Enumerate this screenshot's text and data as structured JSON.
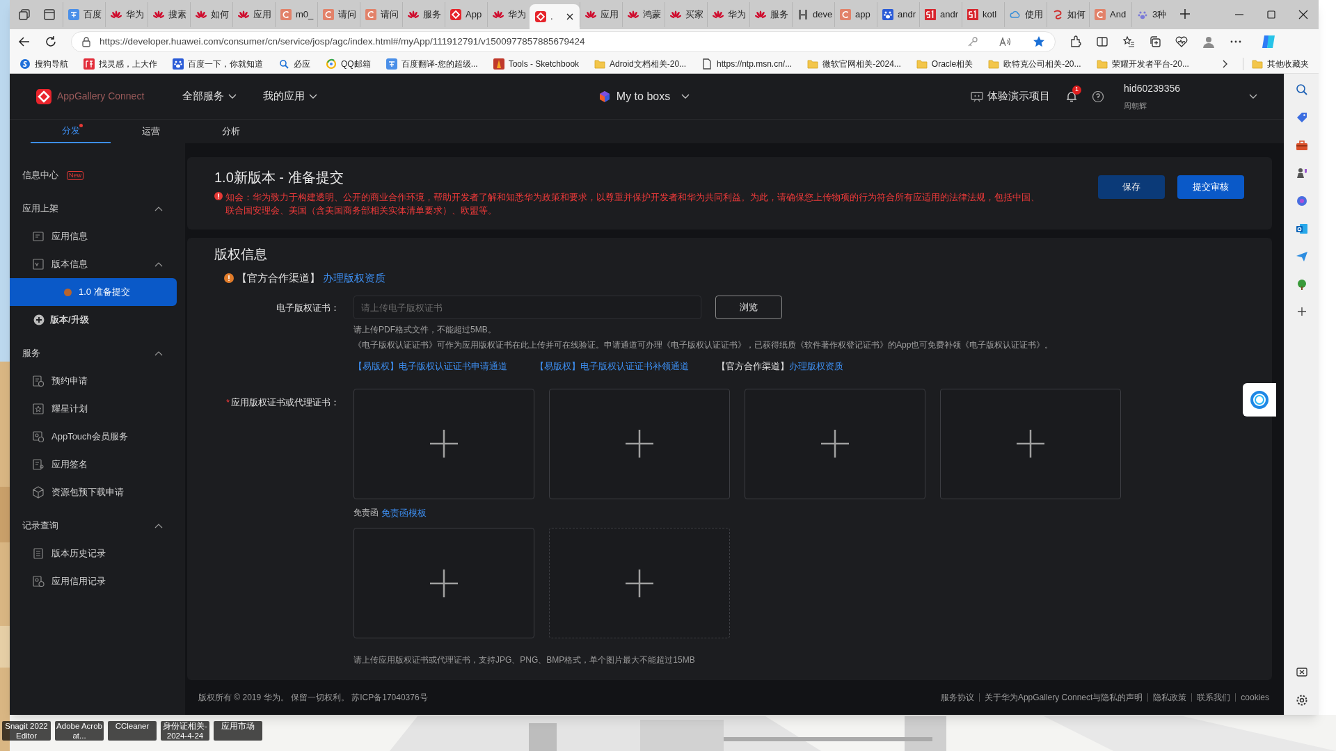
{
  "desktop": {
    "icons": [
      {
        "label": "Snagit 2022 Editor"
      },
      {
        "label": "Adobe Acrobat..."
      },
      {
        "label": "CCleaner"
      },
      {
        "label": "身份证相关-2024-4-24"
      },
      {
        "label": "应用市场"
      }
    ]
  },
  "browser": {
    "tabs": [
      {
        "title": "百度",
        "kind": "translate",
        "selected": false
      },
      {
        "title": "华为",
        "kind": "huawei",
        "selected": false
      },
      {
        "title": "搜素",
        "kind": "huawei",
        "selected": false
      },
      {
        "title": "如何",
        "kind": "huawei",
        "selected": false
      },
      {
        "title": "应用",
        "kind": "huawei",
        "selected": false
      },
      {
        "title": "m0_",
        "kind": "c",
        "selected": false
      },
      {
        "title": "请问",
        "kind": "c",
        "selected": false
      },
      {
        "title": "请问",
        "kind": "c",
        "selected": false
      },
      {
        "title": "服务",
        "kind": "huawei",
        "selected": false
      },
      {
        "title": "App",
        "kind": "agc",
        "selected": false
      },
      {
        "title": "华为",
        "kind": "huawei",
        "selected": false
      },
      {
        "title": ".",
        "kind": "agc",
        "selected": true
      },
      {
        "title": "应用",
        "kind": "huawei",
        "selected": false
      },
      {
        "title": "鸿蒙",
        "kind": "huawei",
        "selected": false
      },
      {
        "title": "买家",
        "kind": "huawei",
        "selected": false
      },
      {
        "title": "华为",
        "kind": "huawei",
        "selected": false
      },
      {
        "title": "服务",
        "kind": "huawei",
        "selected": false
      },
      {
        "title": "deve",
        "kind": "h",
        "selected": false
      },
      {
        "title": "app",
        "kind": "c",
        "selected": false
      },
      {
        "title": "andr",
        "kind": "baidu",
        "selected": false
      },
      {
        "title": "andr",
        "kind": "number",
        "selected": false
      },
      {
        "title": "kotl",
        "kind": "number",
        "selected": false
      },
      {
        "title": "使用",
        "kind": "cloud",
        "selected": false
      },
      {
        "title": "如何",
        "kind": "yi",
        "selected": false
      },
      {
        "title": "And",
        "kind": "c",
        "selected": false
      },
      {
        "title": "3种",
        "kind": "paw",
        "selected": false
      }
    ],
    "url": "https://developer.huawei.com/consumer/cn/service/josp/agc/index.html#/myApp/111912791/v1500977857885679424",
    "bookmarks": [
      {
        "label": "搜狗导航",
        "kind": "sogou"
      },
      {
        "label": "找灵感，上大作",
        "kind": "zuo"
      },
      {
        "label": "百度一下，你就知道",
        "kind": "baidu"
      },
      {
        "label": "必应",
        "kind": "search"
      },
      {
        "label": "QQ邮箱",
        "kind": "qq"
      },
      {
        "label": "百度翻译-您的超级...",
        "kind": "translate"
      },
      {
        "label": "Tools - Sketchbook",
        "kind": "sketchbook"
      },
      {
        "label": "Adroid文档相关-20...",
        "kind": "folder"
      },
      {
        "label": "https://ntp.msn.cn/...",
        "kind": "page"
      },
      {
        "label": "微软官网相关-2024...",
        "kind": "folder"
      },
      {
        "label": "Oracle相关",
        "kind": "folder"
      },
      {
        "label": "欧特克公司相关-20...",
        "kind": "folder"
      },
      {
        "label": "荣耀开发者平台-20...",
        "kind": "folder"
      }
    ],
    "other_bookmarks": "其他收藏夹"
  },
  "header": {
    "logo_text": "AppGallery Connect",
    "menus": [
      {
        "label": "全部服务"
      },
      {
        "label": "我的应用"
      }
    ],
    "project": "My to boxs",
    "demo": "体验演示项目",
    "notifications": "1",
    "user_id": "hid60239356",
    "user_name": "周朝辉"
  },
  "nav_tabs": [
    {
      "label": "分发",
      "selected": true,
      "dot": true
    },
    {
      "label": "运营",
      "selected": false,
      "dot": false
    },
    {
      "label": "分析",
      "selected": false,
      "dot": false
    }
  ],
  "sidebar": {
    "items": [
      {
        "kind": "plain",
        "label": "信息中心",
        "badge": "New",
        "selected": false
      },
      {
        "kind": "section",
        "label": "应用上架",
        "expanded": true,
        "children": [
          {
            "kind": "form",
            "label": "应用信息",
            "selected": false
          },
          {
            "kind": "version",
            "label": "版本信息",
            "expanded": true,
            "children": [
              {
                "kind": "status",
                "label": "1.0 准备提交",
                "color": "#b8642c",
                "selected": true
              }
            ]
          },
          {
            "kind": "add",
            "label": "版本/升级",
            "selected": false
          }
        ]
      },
      {
        "kind": "section",
        "label": "服务",
        "expanded": true,
        "children": [
          {
            "kind": "calendar",
            "label": "预约申请",
            "selected": false
          },
          {
            "kind": "star",
            "label": "耀星计划",
            "selected": false
          },
          {
            "kind": "members",
            "label": "AppTouch会员服务",
            "selected": false
          },
          {
            "kind": "sign",
            "label": "应用签名",
            "selected": false
          },
          {
            "kind": "package",
            "label": "资源包预下载申请",
            "selected": false
          }
        ]
      },
      {
        "kind": "section",
        "label": "记录查询",
        "expanded": true,
        "children": [
          {
            "kind": "list",
            "label": "版本历史记录",
            "selected": false
          },
          {
            "kind": "credit",
            "label": "应用信用记录",
            "selected": false
          }
        ]
      }
    ]
  },
  "version_panel": {
    "title": "1.0新版本 - 准备提交",
    "notice": "知会：华为致力于构建透明、公开的商业合作环境，帮助开发者了解和知悉华为政策和要求，以尊重并保护开发者和华为共同利益。为此，请确保您上传物项的行为符合所有应适用的法律法规，包括中国、联合国安理会、美国（含美国商务部相关实体清单要求）、欧盟等。",
    "buttons": [
      {
        "label": "保存",
        "kind": "secondary"
      },
      {
        "label": "提交审核",
        "kind": "primary"
      }
    ]
  },
  "copyright": {
    "title": "版权信息",
    "channel_notice": {
      "prefix": "【官方合作渠道】",
      "link": "办理版权资质"
    },
    "certificate": {
      "label": "电子版权证书：",
      "placeholder": "请上传电子版权证书",
      "button": "浏览",
      "hints": [
        "请上传PDF格式文件，不能超过5MB。",
        "《电子版权认证证书》可作为应用版权证书在此上传并可在线验证。申请通道可办理《电子版权认证证书》，已获得纸质《软件著作权登记证书》的App也可免费补领《电子版权认证证书》。"
      ],
      "links": [
        {
          "link": "【易版权】电子版权认证证书申请通道"
        },
        {
          "link": "【易版权】电子版权认证证书补领通道"
        },
        {
          "prefix": "【官方合作渠道】",
          "link": "办理版权资质"
        }
      ]
    },
    "upload": {
      "label": "应用版权证书或代理证书：",
      "required_mark": "*",
      "slots": [
        {
          "dashed": false
        },
        {
          "dashed": false
        },
        {
          "dashed": false
        },
        {
          "dashed": false
        }
      ],
      "disclaimer": {
        "label": "免责函",
        "link": "免责函模板"
      },
      "disclaimer_slots": [
        {
          "dashed": false
        },
        {
          "dashed": true
        }
      ],
      "hint": "请上传应用版权证书或代理证书，支持JPG、PNG、BMP格式，单个图片最大不能超过15MB"
    }
  },
  "footer": {
    "copyright": "版权所有 © 2019 华为。 保留一切权利。 苏ICP备17040376号",
    "links": [
      {
        "label": "服务协议"
      },
      {
        "label": "关于华为AppGallery Connect与隐私的声明"
      },
      {
        "label": "隐私政策"
      },
      {
        "label": "联系我们"
      },
      {
        "label": "cookies"
      }
    ]
  }
}
